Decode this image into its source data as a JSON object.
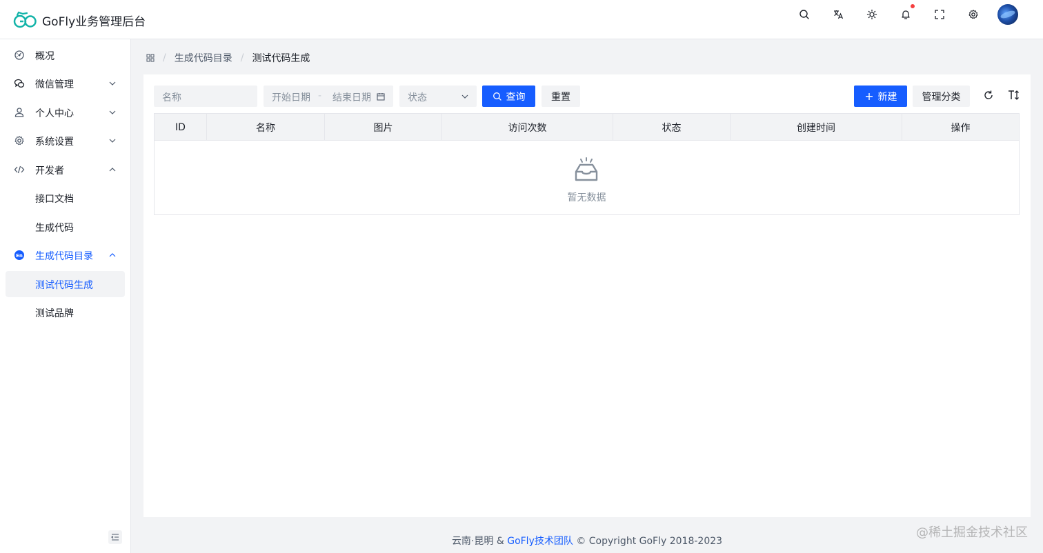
{
  "app": {
    "title": "GoFly业务管理后台"
  },
  "header": {
    "icons": [
      "search-icon",
      "translate-icon",
      "theme-icon",
      "notification-icon",
      "fullscreen-icon",
      "settings-icon"
    ]
  },
  "sidebar": {
    "items": [
      {
        "label": "概况",
        "icon": "dashboard-icon"
      },
      {
        "label": "微信管理",
        "icon": "wechat-icon"
      },
      {
        "label": "个人中心",
        "icon": "user-icon"
      },
      {
        "label": "系统设置",
        "icon": "settings-icon"
      },
      {
        "label": "开发者",
        "icon": "code-icon"
      },
      {
        "label": "接口文档"
      },
      {
        "label": "生成代码"
      },
      {
        "label": "生成代码目录",
        "icon": "en-icon"
      },
      {
        "label": "测试代码生成"
      },
      {
        "label": "测试品牌"
      }
    ]
  },
  "breadcrumb": {
    "items": [
      "生成代码目录",
      "测试代码生成"
    ]
  },
  "filters": {
    "name_placeholder": "名称",
    "start_date_placeholder": "开始日期",
    "date_separator": "-",
    "end_date_placeholder": "结束日期",
    "status_placeholder": "状态"
  },
  "actions": {
    "query": "查询",
    "reset": "重置",
    "new": "新建",
    "manage_category": "管理分类"
  },
  "table": {
    "columns": [
      "ID",
      "名称",
      "图片",
      "访问次数",
      "状态",
      "创建时间",
      "操作"
    ],
    "empty_text": "暂无数据"
  },
  "footer": {
    "prefix": "云南·昆明 & ",
    "team": "GoFly技术团队",
    "copyright": " © Copyright GoFly 2018-2023"
  },
  "watermark": "@稀土掘金技术社区",
  "colors": {
    "primary": "#165dff",
    "notification_dot": "#f53f3f",
    "background": "#f2f3f5"
  }
}
